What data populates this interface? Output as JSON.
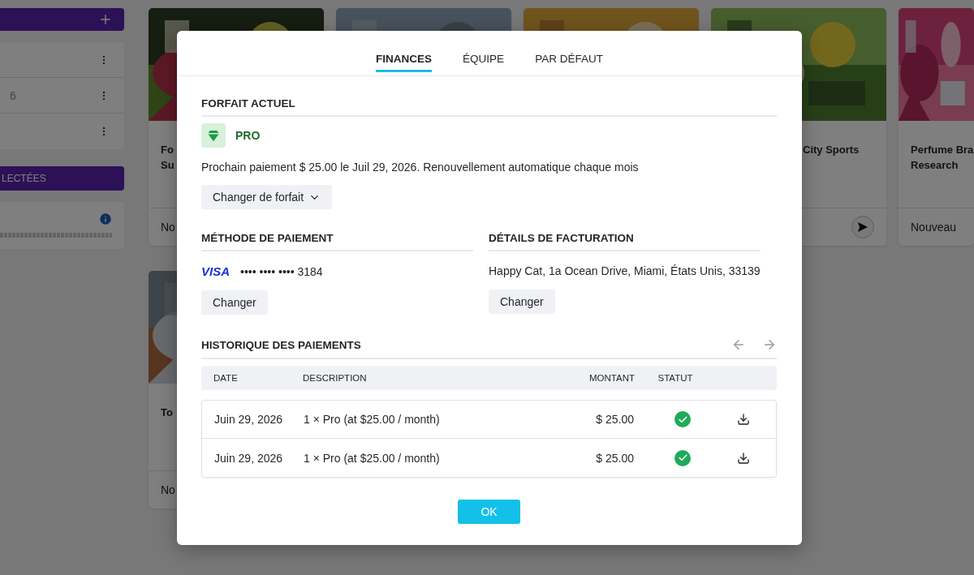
{
  "sidebar": {
    "list_rows": [
      {
        "count": null
      },
      {
        "count": "6"
      },
      {
        "count": null
      }
    ],
    "selected_bar": "LECTÉES"
  },
  "cards": [
    {
      "kind": "picture",
      "title": [
        "Fo",
        "Su"
      ],
      "footer": "No"
    },
    {
      "kind": "picture"
    },
    {
      "kind": "picture"
    },
    {
      "kind": "picture",
      "title": [
        "City Sports"
      ],
      "send": true
    },
    {
      "kind": "picture",
      "title": [
        "Perfume Bra",
        "Research"
      ],
      "footer": "Nouveau"
    },
    {
      "kind": "picture",
      "title": [
        "To"
      ],
      "footer": "No"
    }
  ],
  "modal": {
    "tabs": [
      {
        "label": "FINANCES",
        "selected": true
      },
      {
        "label": "ÉQUIPE",
        "selected": false
      },
      {
        "label": "PAR DÉFAUT",
        "selected": false
      }
    ],
    "plan": {
      "heading": "FORFAIT ACTUEL",
      "name": "PRO",
      "next_payment": "Prochain paiement $ 25.00 le Juil 29, 2026. Renouvellement automatique chaque mois",
      "change_button": "Changer de forfait"
    },
    "payment_method": {
      "heading": "MÉTHODE DE PAIEMENT",
      "brand": "VISA",
      "card_number": "•••• •••• •••• 3184",
      "button": "Changer"
    },
    "billing": {
      "heading": "DÉTAILS DE FACTURATION",
      "address": "Happy Cat, 1a Ocean Drive, Miami, États Unis, 33139",
      "button": "Changer"
    },
    "history": {
      "heading": "HISTORIQUE DES PAIEMENTS",
      "columns": [
        "DATE",
        "DESCRIPTION",
        "MONTANT",
        "STATUT"
      ],
      "rows": [
        {
          "date": "Juin 29, 2026",
          "description": "1 × Pro (at $25.00 / month)",
          "amount": "$ 25.00",
          "paid": true
        },
        {
          "date": "Juin 29, 2026",
          "description": "1 × Pro (at $25.00 / month)",
          "amount": "$ 25.00",
          "paid": true
        }
      ]
    },
    "ok_button": "OK"
  }
}
